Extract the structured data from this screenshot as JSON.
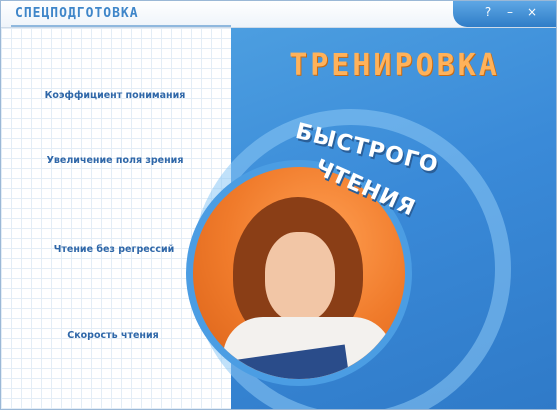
{
  "window": {
    "title": "СПЕЦПОДГОТОВКА",
    "controls": {
      "help": "?",
      "minimize": "–",
      "close": "×"
    }
  },
  "menu": {
    "items": [
      {
        "label": "Коэффициент понимания"
      },
      {
        "label": "Увеличение поля зрения"
      },
      {
        "label": "Чтение без регрессий"
      },
      {
        "label": "Скорость чтения"
      }
    ]
  },
  "banner": {
    "line1": "ТРЕНИРОВКА",
    "line2": "БЫСТРОГО",
    "line3": "ЧТЕНИЯ"
  },
  "colors": {
    "accent": "#3f86c9",
    "panel_blue": "#3a8ad8",
    "heading_orange": "#ffb25a",
    "photo_orange": "#f07b2b",
    "menu_text": "#2f67a8"
  },
  "icons": {
    "help": "help-icon",
    "minimize": "minimize-icon",
    "close": "close-icon"
  }
}
